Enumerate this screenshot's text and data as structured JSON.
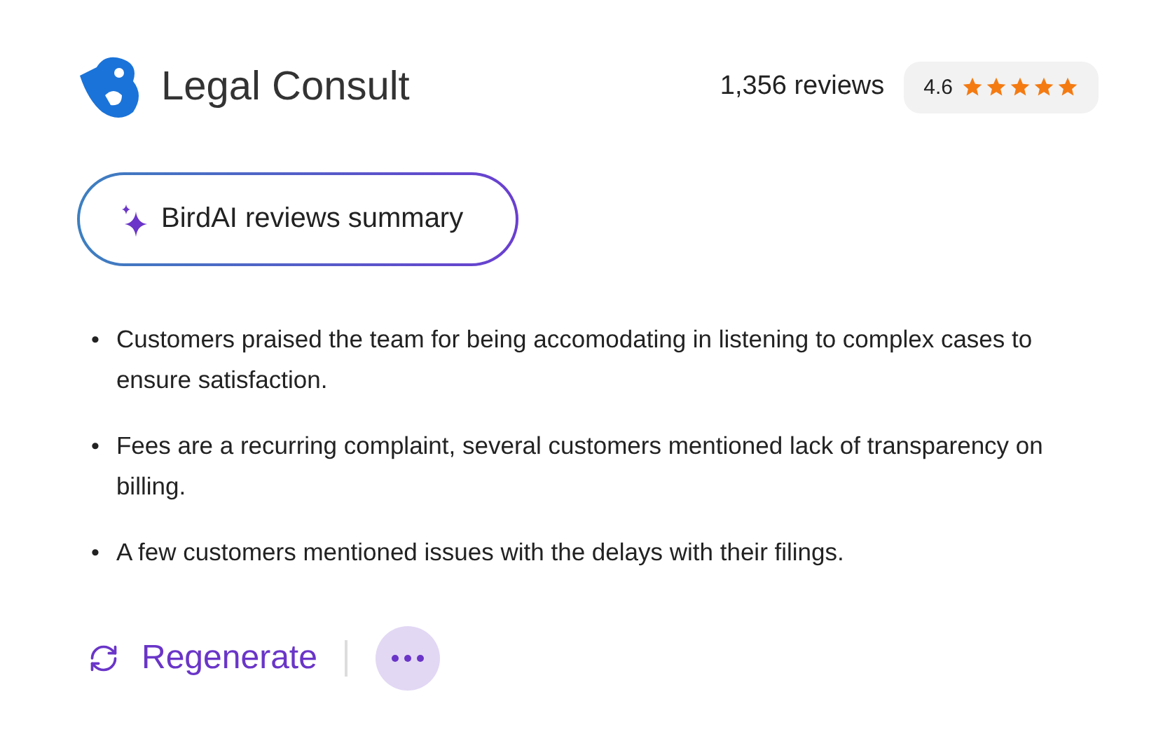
{
  "brand": {
    "name": "Legal Consult"
  },
  "rating": {
    "reviews": "1,356 reviews",
    "score": "4.6",
    "stars": 5
  },
  "summary_title": "BirdAI reviews summary",
  "points": [
    {
      "bullet": "•",
      "text": "Customers praised the team for being accomodating in listening to complex cases to ensure satisfaction."
    },
    {
      "bullet": "•",
      "text": "Fees are a recurring complaint, several customers mentioned lack of transparency on billing."
    },
    {
      "bullet": "•",
      "text": "A few customers mentioned issues with the delays with their filings."
    }
  ],
  "actions": {
    "regenerate": "Regenerate"
  }
}
